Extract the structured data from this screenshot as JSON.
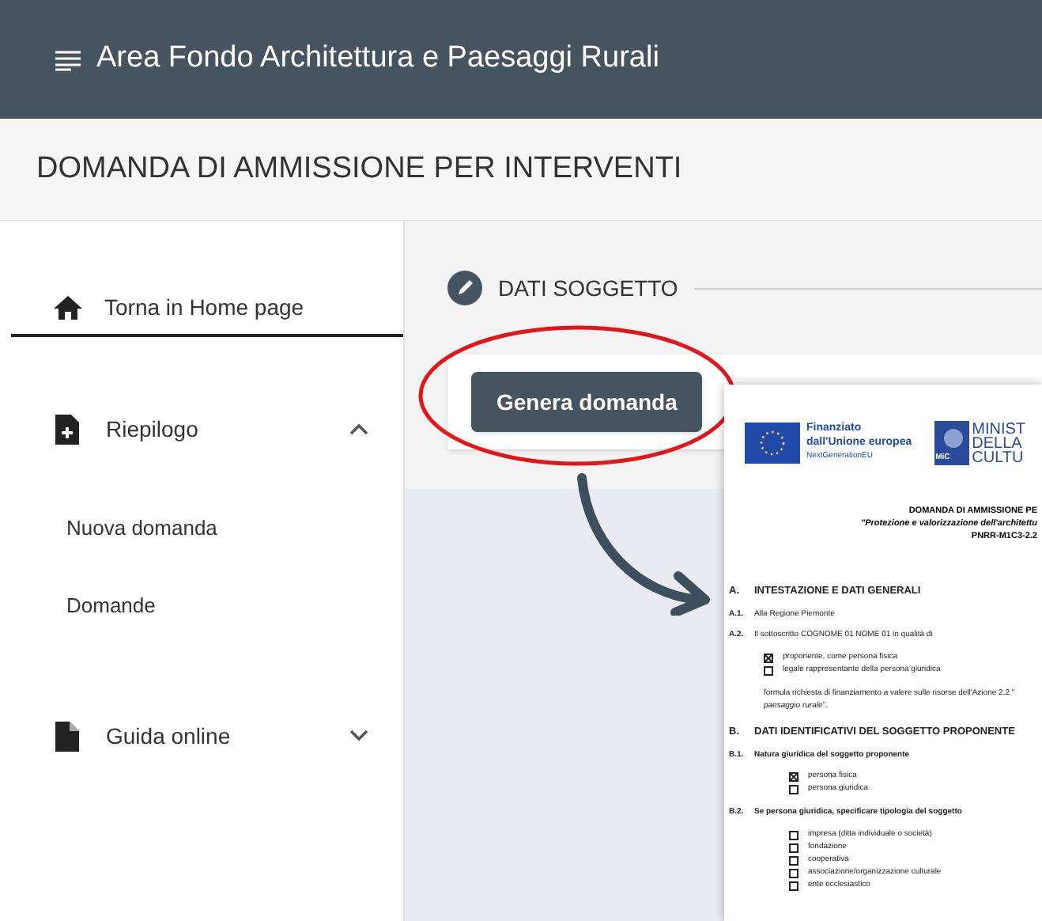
{
  "header": {
    "title": "Area Fondo Architettura e Paesaggi Rurali"
  },
  "page_title": "DOMANDA DI AMMISSIONE PER INTERVENTI",
  "sidebar": {
    "home": "Torna in Home page",
    "sections": [
      {
        "label": "Riepilogo",
        "expanded": true,
        "items": [
          "Nuova domanda",
          "Domande"
        ]
      },
      {
        "label": "Guida online",
        "expanded": false
      }
    ]
  },
  "step": {
    "label": "DATI SOGGETTO"
  },
  "button": "Genera domanda",
  "document": {
    "logo_eu": [
      "Finanziato",
      "dall'Unione europea",
      "NextGenerationEU"
    ],
    "logo_mic": [
      "MINIST",
      "DELLA",
      "CULTU"
    ],
    "logo_mic_mark": "MiC",
    "title": [
      "DOMANDA DI AMMISSIONE PE",
      "\"Protezione e valorizzazione dell'architettu",
      "PNRR-M1C3-2.2"
    ],
    "lines": [
      {
        "kind": "section",
        "num": "A.",
        "text": "INTESTAZIONE E DATI GENERALI"
      },
      {
        "kind": "item",
        "num": "A.1.",
        "text": "Alla Regione Piemonte"
      },
      {
        "kind": "item",
        "num": "A.2.",
        "text": "Il sottoscritto COGNOME 01 NOME 01 in qualità di"
      },
      {
        "kind": "options",
        "options": [
          {
            "label": "proponente, come persona fisica",
            "checked": true
          },
          {
            "label": "legale rappresentante della persona giuridica",
            "checked": false
          }
        ]
      },
      {
        "kind": "para",
        "text": "formula richiesta di finanziamento a valere sulle risorse dell'Azione 2.2 \""
      },
      {
        "kind": "para",
        "text": "*paesaggio rurale*\"."
      },
      {
        "kind": "section",
        "num": "B.",
        "text": "DATI IDENTIFICATIVI DEL SOGGETTO PROPONENTE"
      },
      {
        "kind": "subsection",
        "num": "B.1.",
        "text": "Natura giuridica del soggetto proponente"
      },
      {
        "kind": "options",
        "options": [
          {
            "label": "persona fisica",
            "checked": true
          },
          {
            "label": "persona giuridica",
            "checked": false
          }
        ]
      },
      {
        "kind": "subsection",
        "num": "B.2.",
        "text": "Se persona giuridica, specificare tipologia del soggetto"
      },
      {
        "kind": "options",
        "options": [
          {
            "label": "impresa (ditta individuale o società)",
            "checked": false
          },
          {
            "label": "fondazione",
            "checked": false
          },
          {
            "label": "cooperativa",
            "checked": false
          },
          {
            "label": "associazione/organizzazione culturale",
            "checked": false
          },
          {
            "label": "ente ecclesiastico",
            "checked": false
          }
        ]
      }
    ]
  }
}
